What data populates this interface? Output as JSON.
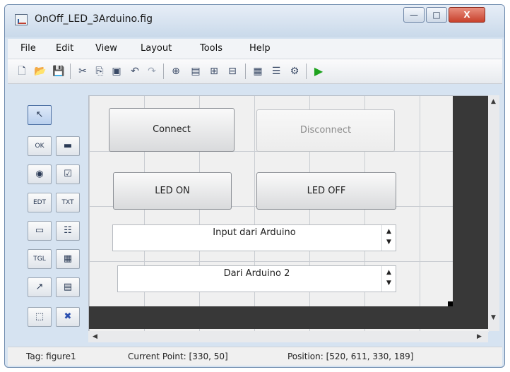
{
  "window": {
    "title": "OnOff_LED_3Arduino.fig",
    "min_glyph": "—",
    "max_glyph": "□",
    "close_glyph": "X"
  },
  "menu": [
    "File",
    "Edit",
    "View",
    "Layout",
    "Tools",
    "Help"
  ],
  "toolbar_icons": [
    "new-file-icon",
    "open-folder-icon",
    "save-icon",
    "cut-icon",
    "copy-icon",
    "paste-icon",
    "undo-icon",
    "redo-icon",
    "align-icon",
    "menu-editor-icon",
    "tab-order-icon",
    "toolbar-editor-icon",
    "m-file-editor-icon",
    "property-inspector-icon",
    "object-browser-icon",
    "run-icon"
  ],
  "palette": [
    {
      "name": "select-tool-icon",
      "glyph": "↖"
    },
    {
      "name": "push-button-tool-icon",
      "glyph": "OK"
    },
    {
      "name": "slider-tool-icon",
      "glyph": "▬"
    },
    {
      "name": "radio-button-tool-icon",
      "glyph": "◉"
    },
    {
      "name": "checkbox-tool-icon",
      "glyph": "☑"
    },
    {
      "name": "edit-text-tool-icon",
      "glyph": "EDT"
    },
    {
      "name": "static-text-tool-icon",
      "glyph": "TXT"
    },
    {
      "name": "popup-menu-tool-icon",
      "glyph": "▭"
    },
    {
      "name": "listbox-tool-icon",
      "glyph": "☷"
    },
    {
      "name": "toggle-button-tool-icon",
      "glyph": "TGL"
    },
    {
      "name": "table-tool-icon",
      "glyph": "▦"
    },
    {
      "name": "axes-tool-icon",
      "glyph": "↗"
    },
    {
      "name": "panel-tool-icon",
      "glyph": "▤"
    },
    {
      "name": "button-group-tool-icon",
      "glyph": "⬚"
    },
    {
      "name": "activex-tool-icon",
      "glyph": "✖"
    }
  ],
  "canvas": {
    "connect": "Connect",
    "disconnect": "Disconnect",
    "led_on": "LED ON",
    "led_off": "LED OFF",
    "input1": "Input dari Arduino",
    "input2": "Dari Arduino 2"
  },
  "status": {
    "tag": "Tag: figure1",
    "current_point": "Current Point:  [330, 50]",
    "position": "Position: [520, 611, 330, 189]"
  },
  "colors": {
    "run": "#1fa31f",
    "canvas_dark": "#383838",
    "close": "#c8412c"
  }
}
